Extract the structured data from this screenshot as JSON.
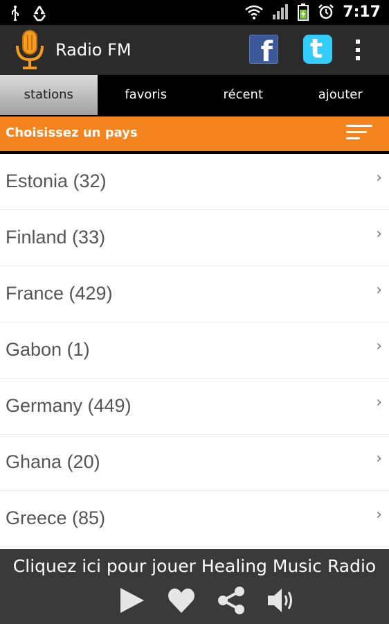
{
  "status_bar": {
    "time": "7:17",
    "icons": [
      "usb-icon",
      "recycle-icon",
      "wifi-icon",
      "signal-icon",
      "battery-icon",
      "alarm-icon"
    ]
  },
  "app_bar": {
    "title": "Radio FM",
    "facebook_letter": "f",
    "twitter_letter": "t",
    "icons": [
      "microphone-icon",
      "facebook-icon",
      "twitter-icon",
      "overflow-menu-icon"
    ]
  },
  "tabs": [
    {
      "label": "stations",
      "active": true
    },
    {
      "label": "favoris",
      "active": false
    },
    {
      "label": "récent",
      "active": false
    },
    {
      "label": "ajouter",
      "active": false
    }
  ],
  "country_header": {
    "title": "Choisissez un pays",
    "icon": "sort-icon"
  },
  "countries": [
    {
      "label": "Estonia (32)"
    },
    {
      "label": "Finland (33)"
    },
    {
      "label": "France (429)"
    },
    {
      "label": "Gabon (1)"
    },
    {
      "label": "Germany (449)"
    },
    {
      "label": "Ghana (20)"
    },
    {
      "label": "Greece (85)"
    }
  ],
  "player": {
    "text": "Cliquez ici pour jouer Healing Music Radio",
    "controls": [
      "play-icon",
      "heart-icon",
      "share-icon",
      "volume-icon"
    ]
  },
  "colors": {
    "accent": "#f6841e",
    "action_bar": "#2b2b2b",
    "player_bg": "#3a3a3a",
    "facebook": "#3b5998",
    "twitter": "#33ccff"
  }
}
